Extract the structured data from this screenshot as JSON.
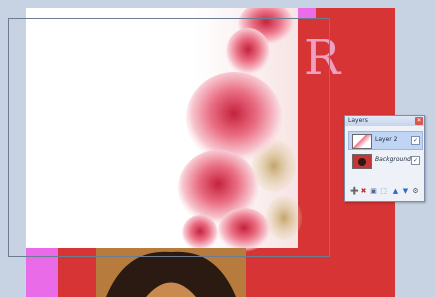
{
  "canvas": {
    "letter": "R",
    "colors": {
      "red": "#d63435",
      "pink": "#ea6de8",
      "letter": "#f0a6c9"
    }
  },
  "layers_panel": {
    "title": "Layers",
    "close_symbol": "✕",
    "layers": [
      {
        "name": "Layer 2",
        "selected": true,
        "visible": true,
        "check": "✓"
      },
      {
        "name": "Background",
        "selected": false,
        "visible": true,
        "check": "✓"
      }
    ],
    "tool_icons": [
      "add-layer-icon",
      "delete-layer-icon",
      "duplicate-layer-icon",
      "merge-layer-icon",
      "move-up-icon",
      "move-down-icon",
      "properties-icon"
    ],
    "tool_symbols": [
      "➕",
      "✖",
      "▣",
      "⬚",
      "▲",
      "▼",
      "⚙"
    ]
  }
}
